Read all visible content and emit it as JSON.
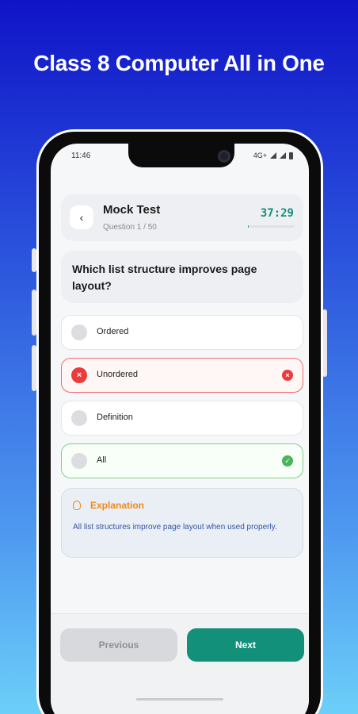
{
  "banner": {
    "title": "Class 8 Computer All in One"
  },
  "status_bar": {
    "time": "11:46",
    "network": "4G+"
  },
  "header": {
    "title": "Mock Test",
    "question_counter": "Question 1 / 50",
    "timer": "37:29",
    "progress_fraction": 0.02
  },
  "question": {
    "text": "Which list structure improves page layout?"
  },
  "options": [
    {
      "label": "Ordered",
      "state": "neutral"
    },
    {
      "label": "Unordered",
      "state": "wrong"
    },
    {
      "label": "Definition",
      "state": "neutral"
    },
    {
      "label": "All",
      "state": "correct"
    }
  ],
  "explanation": {
    "title": "Explanation",
    "body": "All list structures improve page layout when used properly."
  },
  "footer": {
    "previous_label": "Previous",
    "next_label": "Next"
  },
  "colors": {
    "accent": "#12907a",
    "wrong": "#ec3b3b",
    "correct": "#49b55a",
    "explanation": "#ef8a14"
  },
  "icons": {
    "back": "chevron-left-icon",
    "wrong_mark": "close-circle-icon",
    "correct_mark": "check-circle-icon",
    "hint": "lightbulb-icon"
  }
}
